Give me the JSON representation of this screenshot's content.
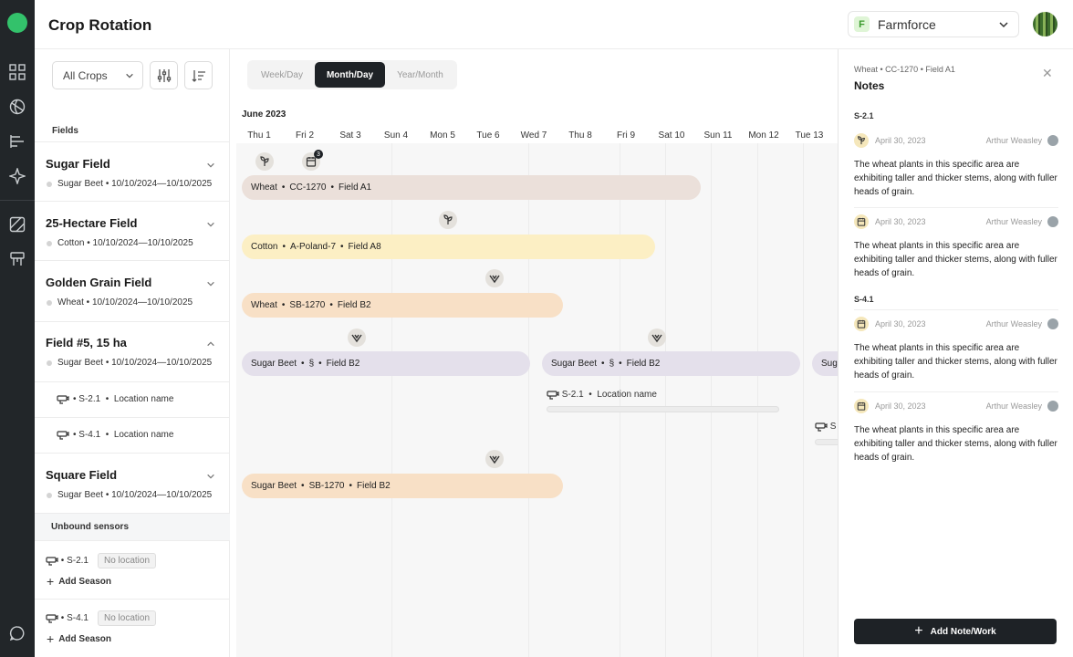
{
  "app": {
    "title": "Crop Rotation",
    "org_badge": "F",
    "org_name": "Farmforce"
  },
  "rail": {
    "icons": [
      "brand-logo-icon",
      "grid-icon",
      "globe-icon",
      "chart-bars-icon",
      "sparkle-icon",
      "map-icon",
      "sign-icon",
      "chat-icon"
    ]
  },
  "filters": {
    "crop_dropdown": "All Crops"
  },
  "fields_panel": {
    "label": "Fields",
    "fields": [
      {
        "name": "Sugar Field",
        "crop": "Sugar Beet",
        "dates": "10/10/2024—10/10/2025",
        "expanded": false
      },
      {
        "name": "25-Hectare Field",
        "crop": "Cotton",
        "dates": "10/10/2024—10/10/2025",
        "expanded": false
      },
      {
        "name": "Golden Grain Field",
        "crop": "Wheat",
        "dates": "10/10/2024—10/10/2025",
        "expanded": false
      },
      {
        "name": "Field #5, 15 ha",
        "crop": "Sugar Beet",
        "dates": "10/10/2024—10/10/2025",
        "expanded": true,
        "sensors": [
          {
            "id": "S-2.1",
            "location": "Location name"
          },
          {
            "id": "S-4.1",
            "location": "Location name"
          }
        ]
      },
      {
        "name": "Square Field",
        "crop": "Sugar Beet",
        "dates": "10/10/2024—10/10/2025",
        "expanded": false
      }
    ],
    "unbound_label": "Unbound sensors",
    "unbound": [
      {
        "id": "S-2.1",
        "location": "No location",
        "action": "Add Season"
      },
      {
        "id": "S-4.1",
        "location": "No location",
        "action": "Add Season"
      }
    ]
  },
  "timeline": {
    "view_tabs": [
      "Week/Day",
      "Month/Day",
      "Year/Month"
    ],
    "active_view": "Month/Day",
    "month": "June 2023",
    "days": [
      "Thu 1",
      "Fri 2",
      "Sat 3",
      "Sun 4",
      "Mon 5",
      "Tue 6",
      "Wed 7",
      "Thu 8",
      "Fri 9",
      "Sat 10",
      "Sun 11",
      "Mon 12",
      "Tue 13"
    ],
    "bars": [
      {
        "crop": "Wheat",
        "code": "CC-1270",
        "field": "Field A1"
      },
      {
        "crop": "Cotton",
        "code": "A-Poland-7",
        "field": "Field A8"
      },
      {
        "crop": "Wheat",
        "code": "SB-1270",
        "field": "Field B2"
      },
      {
        "crop": "Sugar Beet",
        "code": "§",
        "field": "Field B2"
      },
      {
        "crop": "Sugar Beet",
        "code": "§",
        "field": "Field B2"
      },
      {
        "crop": "Suga",
        "code": "",
        "field": ""
      },
      {
        "crop": "Sugar Beet",
        "code": "SB-1270",
        "field": "Field B2"
      }
    ],
    "event_badge_count": "3",
    "sensor_row": {
      "id": "S-2.1",
      "location": "Location name"
    },
    "sensor_row2": {
      "id": "S"
    },
    "colors": {
      "wheat_cc": "#ebe0da",
      "cotton": "#fcefc4",
      "wheat_sb": "#f8e0c6",
      "sugar_beet": "#e4e0eb",
      "sugar_beet_sb": "#f8e0c6"
    }
  },
  "notes": {
    "breadcrumb": [
      "Wheat",
      "CC-1270",
      "Field A1"
    ],
    "title": "Notes",
    "sections": [
      {
        "label": "S-2.1",
        "items": [
          {
            "icon": "seedling-icon",
            "date": "April 30, 2023",
            "author": "Arthur Weasley",
            "text": "The wheat plants in this specific area are exhibiting taller and thicker stems, along with fuller heads of grain."
          },
          {
            "icon": "calendar-icon",
            "date": "April 30, 2023",
            "author": "Arthur Weasley",
            "text": "The wheat plants in this specific area are exhibiting taller and thicker stems, along with fuller heads of grain."
          }
        ]
      },
      {
        "label": "S-4.1",
        "items": [
          {
            "icon": "calendar-icon",
            "date": "April 30, 2023",
            "author": "Arthur Weasley",
            "text": "The wheat plants in this specific area are exhibiting taller and thicker stems, along with fuller heads of grain."
          },
          {
            "icon": "calendar-icon",
            "date": "April 30, 2023",
            "author": "Arthur Weasley",
            "text": "The wheat plants in this specific area are exhibiting taller and thicker stems, along with fuller heads of grain."
          }
        ]
      }
    ],
    "add_button": "Add Note/Work"
  }
}
